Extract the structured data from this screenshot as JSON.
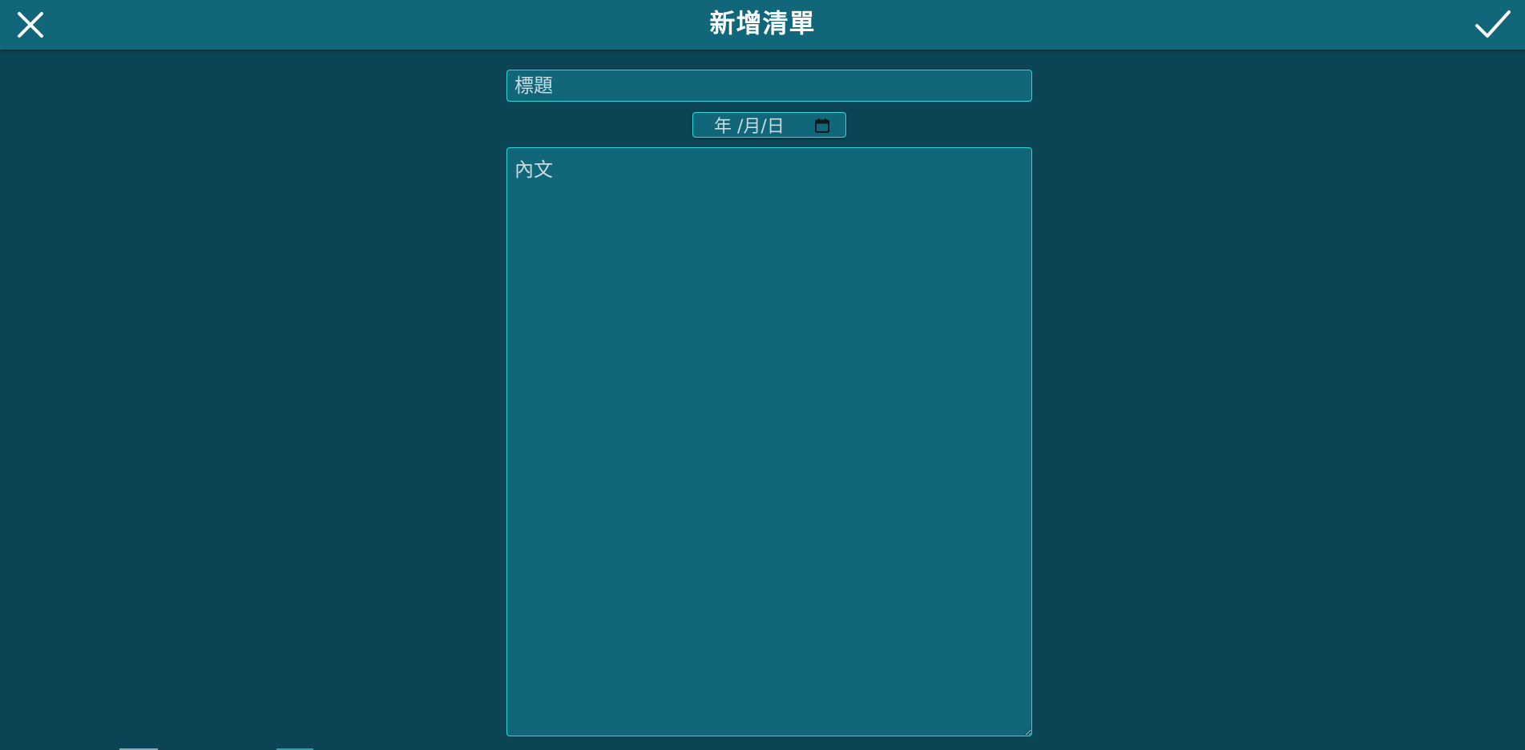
{
  "header": {
    "title": "新增清單",
    "close_icon": "close-icon",
    "confirm_icon": "check-icon"
  },
  "form": {
    "title_placeholder": "標題",
    "date_placeholder": "年 /月/日",
    "date_icon": "calendar-icon",
    "content_placeholder": "內文"
  },
  "colors": {
    "background": "#0b4555",
    "header_bg": "#12667a",
    "field_bg": "#12667a",
    "field_border": "#2fd6d6",
    "text": "#ffffff"
  }
}
